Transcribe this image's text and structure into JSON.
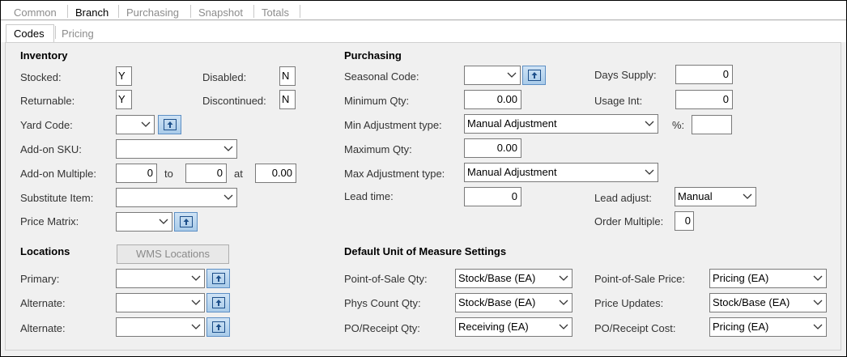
{
  "tabs": [
    "Common",
    "Branch",
    "Purchasing",
    "Snapshot",
    "Totals"
  ],
  "subtabs": [
    "Codes",
    "Pricing"
  ],
  "inventory": {
    "heading": "Inventory",
    "stocked_label": "Stocked:",
    "stocked_value": "Y",
    "disabled_label": "Disabled:",
    "disabled_value": "N",
    "returnable_label": "Returnable:",
    "returnable_value": "Y",
    "discontinued_label": "Discontinued:",
    "discontinued_value": "N",
    "yard_code_label": "Yard Code:",
    "yard_code_value": "",
    "addon_sku_label": "Add-on SKU:",
    "addon_sku_value": "",
    "addon_multiple_label": "Add-on Multiple:",
    "addon_from": "0",
    "to_label": "to",
    "addon_to": "0",
    "at_label": "at",
    "addon_at": "0.00",
    "substitute_label": "Substitute Item:",
    "substitute_value": "",
    "price_matrix_label": "Price Matrix:",
    "price_matrix_value": ""
  },
  "locations": {
    "heading": "Locations",
    "wms_button": "WMS Locations",
    "primary_label": "Primary:",
    "primary_value": "",
    "alternate1_label": "Alternate:",
    "alternate1_value": "",
    "alternate2_label": "Alternate:",
    "alternate2_value": ""
  },
  "purchasing": {
    "heading": "Purchasing",
    "seasonal_label": "Seasonal Code:",
    "seasonal_value": "",
    "days_supply_label": "Days Supply:",
    "days_supply_value": "0",
    "min_qty_label": "Minimum Qty:",
    "min_qty_value": "0.00",
    "usage_int_label": "Usage Int:",
    "usage_int_value": "0",
    "min_adj_label": "Min Adjustment type:",
    "min_adj_value": "Manual Adjustment",
    "pct_label": "%:",
    "pct_value": "",
    "max_qty_label": "Maximum Qty:",
    "max_qty_value": "0.00",
    "max_adj_label": "Max Adjustment type:",
    "max_adj_value": "Manual Adjustment",
    "lead_time_label": "Lead time:",
    "lead_time_value": "0",
    "lead_adjust_label": "Lead adjust:",
    "lead_adjust_value": "Manual",
    "order_multiple_label": "Order Multiple:",
    "order_multiple_value": "0"
  },
  "uom": {
    "heading": "Default Unit of Measure Settings",
    "pos_qty_label": "Point-of-Sale Qty:",
    "pos_qty_value": "Stock/Base (EA)",
    "pos_price_label": "Point-of-Sale Price:",
    "pos_price_value": "Pricing (EA)",
    "phys_count_label": "Phys Count Qty:",
    "phys_count_value": "Stock/Base (EA)",
    "price_updates_label": "Price Updates:",
    "price_updates_value": "Stock/Base (EA)",
    "po_qty_label": "PO/Receipt Qty:",
    "po_qty_value": "Receiving (EA)",
    "po_cost_label": "PO/Receipt Cost:",
    "po_cost_value": "Pricing (EA)"
  }
}
